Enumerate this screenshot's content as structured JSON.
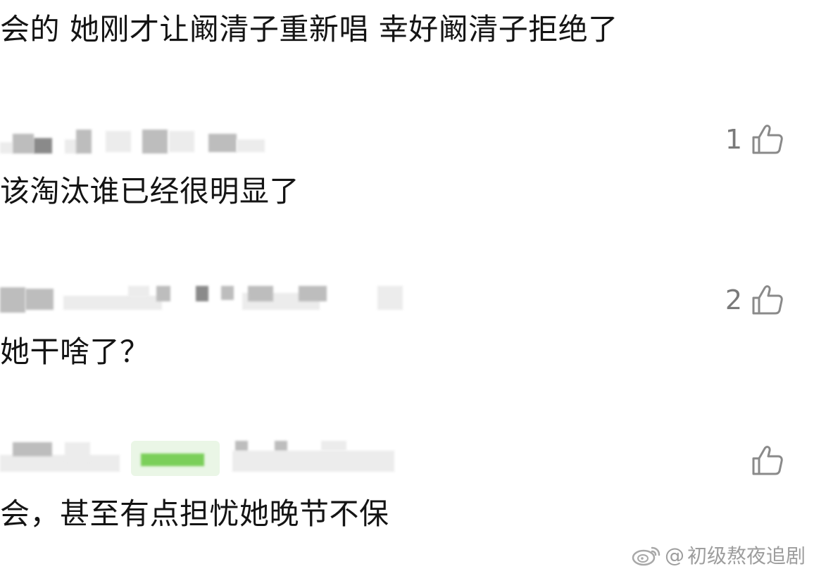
{
  "comments": [
    {
      "text": "会的 她刚才让阚清子重新唱 幸好阚清子拒绝了",
      "likes": ""
    },
    {
      "text": "该淘汰谁已经很明显了",
      "likes": "1"
    },
    {
      "text": "她干啥了？",
      "likes": "2"
    },
    {
      "text": "会，甚至有点担忧她晚节不保",
      "likes": ""
    }
  ],
  "watermark": {
    "prefix": "@",
    "account": "初级熬夜追剧"
  },
  "icons": {
    "like": "thumbs-up-icon",
    "weibo": "weibo-logo-icon"
  },
  "colors": {
    "text": "#141414",
    "meta_gray": "#7a7a7a",
    "badge_green_bg": "#eaf6e6",
    "badge_green": "#4caf2f"
  }
}
